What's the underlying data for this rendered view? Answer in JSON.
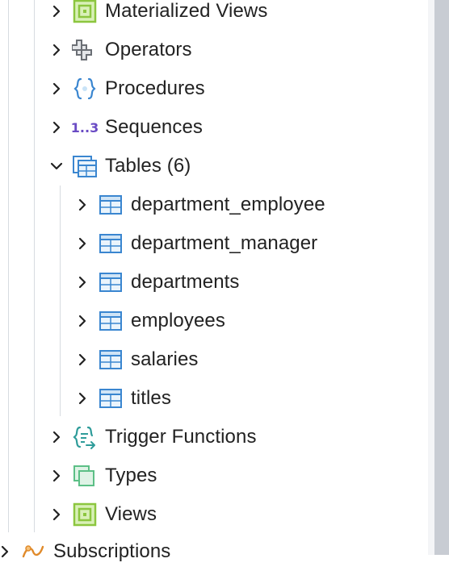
{
  "tree": {
    "schema_items": [
      {
        "label": "Materialized Views",
        "icon": "materialized-view-icon",
        "expanded": false
      },
      {
        "label": "Operators",
        "icon": "operator-icon",
        "expanded": false
      },
      {
        "label": "Procedures",
        "icon": "procedure-icon",
        "expanded": false
      },
      {
        "label": "Sequences",
        "icon": "sequence-icon",
        "icon_text": "1..3",
        "expanded": false
      },
      {
        "label": "Tables (6)",
        "icon": "tables-icon",
        "expanded": true
      },
      {
        "label": "Trigger Functions",
        "icon": "trigger-function-icon",
        "expanded": false
      },
      {
        "label": "Types",
        "icon": "type-icon",
        "expanded": false
      },
      {
        "label": "Views",
        "icon": "view-icon",
        "expanded": false
      }
    ],
    "tables": [
      {
        "label": "department_employee",
        "icon": "table-icon"
      },
      {
        "label": "department_manager",
        "icon": "table-icon"
      },
      {
        "label": "departments",
        "icon": "table-icon"
      },
      {
        "label": "employees",
        "icon": "table-icon"
      },
      {
        "label": "salaries",
        "icon": "table-icon"
      },
      {
        "label": "titles",
        "icon": "table-icon"
      }
    ],
    "database_items": [
      {
        "label": "Subscriptions",
        "icon": "subscriptions-icon",
        "expanded": false
      }
    ]
  },
  "colors": {
    "text": "#222222",
    "chevron": "#222222",
    "green_icon": "#8cc63f",
    "table_icon": "#3a86d0",
    "sequence_icon": "#6a4bc4",
    "gray_icon": "#6b6f75",
    "guide_line": "#d7dbe0"
  }
}
